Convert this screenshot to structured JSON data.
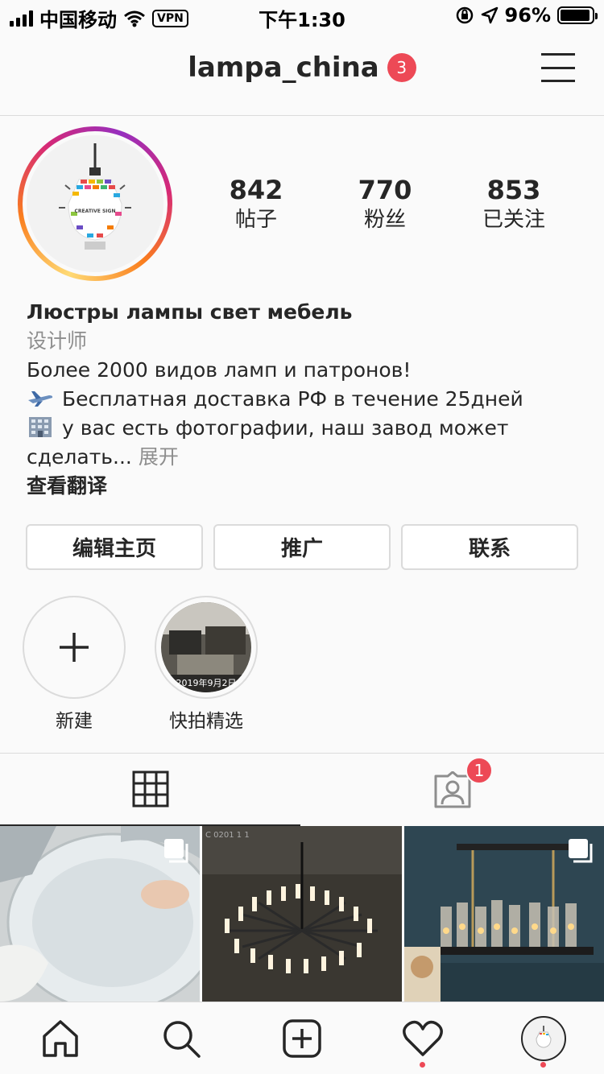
{
  "status_bar": {
    "carrier": "中国移动",
    "vpn": "VPN",
    "time": "下午1:30",
    "battery": "96%",
    "battery_level": 0.96
  },
  "header": {
    "username": "lampa_china",
    "notification_count": "3"
  },
  "profile": {
    "avatar_text": "CREATIVE SIGN",
    "stats": [
      {
        "value": "842",
        "label": "帖子"
      },
      {
        "value": "770",
        "label": "粉丝"
      },
      {
        "value": "853",
        "label": "已关注"
      }
    ],
    "bio": {
      "name": "Люстры лампы свет мебель",
      "category": "设计师",
      "line1": "Более 2000 видов ламп и патронов!",
      "line2": "Бесплатная доставка РФ в течение 25дней",
      "line3": "у вас есть фотографии, наш завод может",
      "line4": "сделать...",
      "more": "展开",
      "translate": "查看翻译"
    }
  },
  "buttons": {
    "edit_profile": "编辑主页",
    "promote": "推广",
    "contact": "联系"
  },
  "highlights": [
    {
      "label": "新建",
      "icon": "plus-icon"
    },
    {
      "label": "快拍精选",
      "cover_text": "2019年9月2日"
    }
  ],
  "tabs": {
    "grid_icon": "grid-icon",
    "tagged_icon": "tagged-person-icon",
    "tagged_badge": "1"
  },
  "posts": [
    {
      "caption": "",
      "multi": true
    },
    {
      "caption": "C 0201 1 1",
      "multi": false
    },
    {
      "caption": "",
      "multi": true
    }
  ],
  "nav": [
    "home-icon",
    "search-icon",
    "new-post-icon",
    "activity-heart-icon",
    "profile-avatar"
  ]
}
